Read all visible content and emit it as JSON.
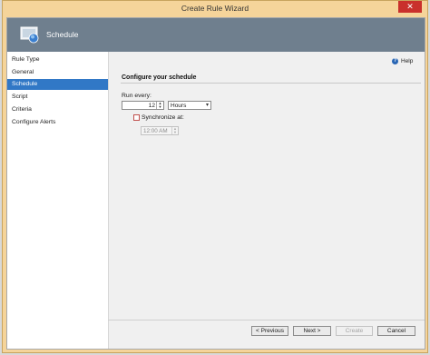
{
  "window": {
    "title": "Create Rule Wizard",
    "close_label": "✕"
  },
  "header": {
    "title": "Schedule",
    "icon": "schedule-page-icon"
  },
  "sidebar": {
    "items": [
      {
        "label": "Rule Type",
        "active": false
      },
      {
        "label": "General",
        "active": false
      },
      {
        "label": "Schedule",
        "active": true
      },
      {
        "label": "Script",
        "active": false
      },
      {
        "label": "Criteria",
        "active": false
      },
      {
        "label": "Configure Alerts",
        "active": false
      }
    ]
  },
  "help": {
    "label": "Help",
    "icon_glyph": "?"
  },
  "main": {
    "section_title": "Configure your schedule",
    "run_every_label": "Run every:",
    "run_every_value": "12",
    "unit_value": "Hours",
    "synchronize": {
      "label": "Synchronize at:",
      "checked": false
    },
    "sync_time": "12:00 AM"
  },
  "buttons": {
    "previous": "< Previous",
    "next": "Next >",
    "create": "Create",
    "cancel": "Cancel"
  },
  "colors": {
    "accent": "#3178c6",
    "header_bg": "#6f7f8e",
    "frame": "#f5d49a",
    "close": "#c9302c"
  }
}
